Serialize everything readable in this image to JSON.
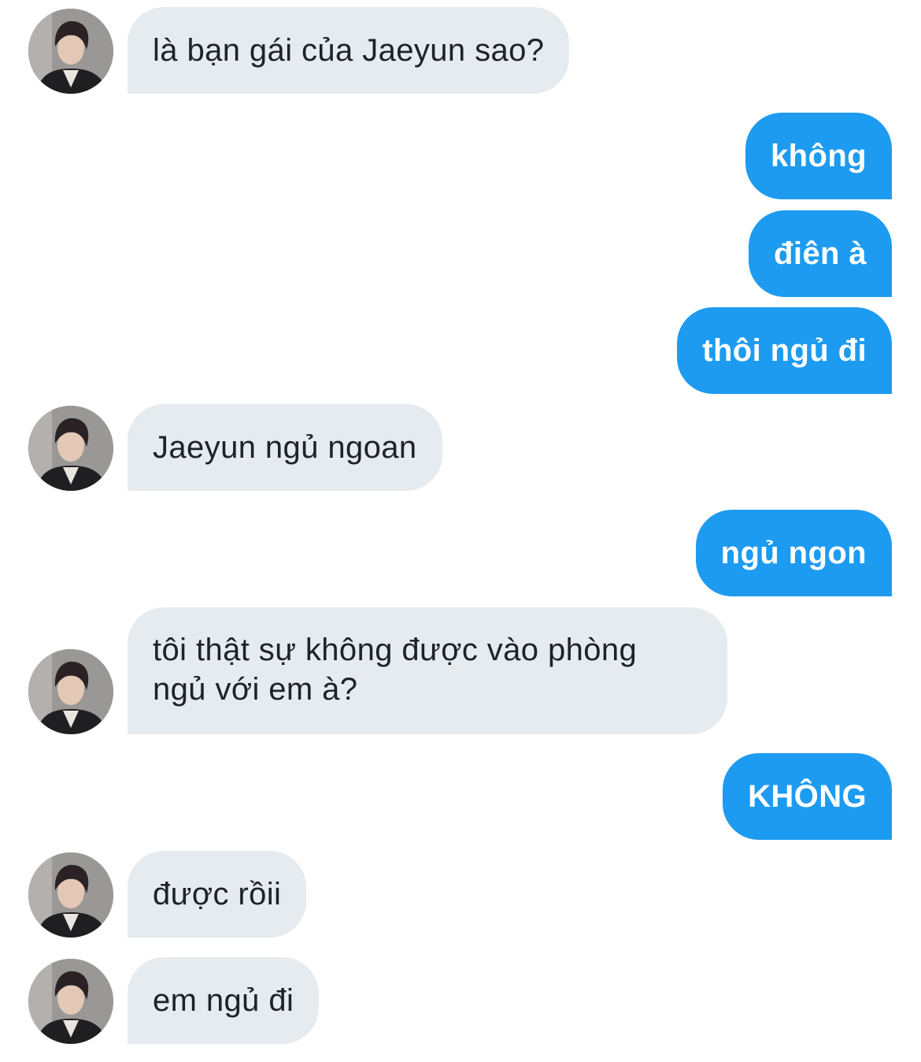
{
  "colors": {
    "incoming_bubble": "#e6ebef",
    "incoming_text": "#1c2329",
    "outgoing_bubble": "#1d9bf0",
    "outgoing_text": "#ffffff",
    "background": "#ffffff"
  },
  "avatar_icon": "profile-photo",
  "messages": [
    {
      "side": "incoming",
      "lines": [
        "là bạn gái của Jaeyun sao?"
      ],
      "show_avatar": true
    },
    {
      "side": "outgoing",
      "lines": [
        "không"
      ]
    },
    {
      "side": "outgoing",
      "lines": [
        "điên à"
      ]
    },
    {
      "side": "outgoing",
      "lines": [
        "thôi ngủ đi"
      ]
    },
    {
      "side": "incoming",
      "lines": [
        "Jaeyun ngủ ngoan"
      ],
      "show_avatar": true
    },
    {
      "side": "outgoing",
      "lines": [
        "ngủ ngon"
      ]
    },
    {
      "side": "incoming",
      "lines": [
        "tôi thật sự không được vào phòng",
        "ngủ với em à?"
      ],
      "show_avatar": true
    },
    {
      "side": "outgoing",
      "lines": [
        "KHÔNG"
      ]
    },
    {
      "side": "incoming",
      "lines": [
        "được rồii"
      ],
      "show_avatar": true
    },
    {
      "side": "incoming",
      "lines": [
        "em ngủ đi"
      ],
      "show_avatar": true
    }
  ]
}
